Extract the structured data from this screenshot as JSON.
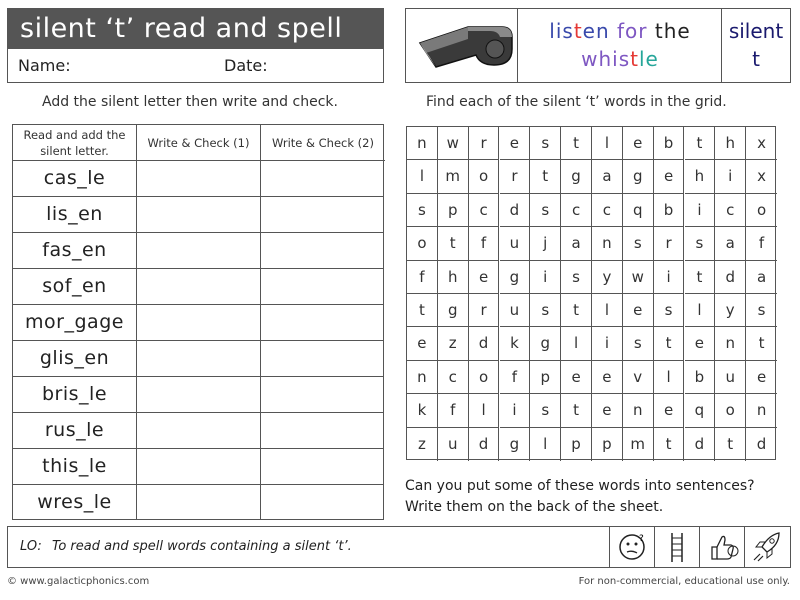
{
  "title": "silent ‘t’ read and spell (1)",
  "name_label": "Name:",
  "date_label": "Date:",
  "header": {
    "listen_line1": [
      "lis",
      "t",
      "en ",
      "for",
      " the"
    ],
    "listen_line2": [
      "whis",
      "t",
      "le"
    ],
    "silent_line1": "silent",
    "silent_line2": "t",
    "colors": {
      "highlight": "#e53935",
      "blue": "#3949ab",
      "purple": "#7e57c2",
      "teal": "#26a69a"
    }
  },
  "left_instruction": "Add the silent letter then write and check.",
  "right_instruction": "Find each of the silent ‘t’ words in the grid.",
  "table": {
    "col1": "Read and add the silent letter.",
    "col2": "Write & Check (1)",
    "col3": "Write & Check (2)",
    "words": [
      "cas_le",
      "lis_en",
      "fas_en",
      "sof_en",
      "mor_gage",
      "glis_en",
      "bris_le",
      "rus_le",
      "this_le",
      "wres_le"
    ]
  },
  "grid": [
    [
      "n",
      "w",
      "r",
      "e",
      "s",
      "t",
      "l",
      "e",
      "b",
      "t",
      "h",
      "x"
    ],
    [
      "l",
      "m",
      "o",
      "r",
      "t",
      "g",
      "a",
      "g",
      "e",
      "h",
      "i",
      "x"
    ],
    [
      "s",
      "p",
      "c",
      "d",
      "s",
      "c",
      "c",
      "q",
      "b",
      "i",
      "c",
      "o"
    ],
    [
      "o",
      "t",
      "f",
      "u",
      "j",
      "a",
      "n",
      "s",
      "r",
      "s",
      "a",
      "f"
    ],
    [
      "f",
      "h",
      "e",
      "g",
      "i",
      "s",
      "y",
      "w",
      "i",
      "t",
      "d",
      "a"
    ],
    [
      "t",
      "g",
      "r",
      "u",
      "s",
      "t",
      "l",
      "e",
      "s",
      "l",
      "y",
      "s"
    ],
    [
      "e",
      "z",
      "d",
      "k",
      "g",
      "l",
      "i",
      "s",
      "t",
      "e",
      "n",
      "t"
    ],
    [
      "n",
      "c",
      "o",
      "f",
      "p",
      "e",
      "e",
      "v",
      "l",
      "b",
      "u",
      "e"
    ],
    [
      "k",
      "f",
      "l",
      "i",
      "s",
      "t",
      "e",
      "n",
      "e",
      "q",
      "o",
      "n"
    ],
    [
      "z",
      "u",
      "d",
      "g",
      "l",
      "p",
      "p",
      "m",
      "t",
      "d",
      "t",
      "d"
    ]
  ],
  "sentences_1": "Can you put some of these words into sentences?",
  "sentences_2": "Write them on the back of the sheet.",
  "lo_label": "LO:",
  "lo_text": "To read and spell words containing a silent ‘t’.",
  "icons": [
    "thinking-face-icon",
    "ladder-icon",
    "thumbs-up-icon",
    "rocket-icon"
  ],
  "footer_left": "© www.galacticphonics.com",
  "footer_right": "For non-commercial, educational use only."
}
